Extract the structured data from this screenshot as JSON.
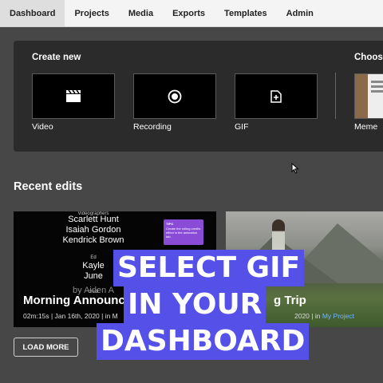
{
  "nav": {
    "tabs": [
      {
        "label": "Dashboard",
        "active": true
      },
      {
        "label": "Projects"
      },
      {
        "label": "Media"
      },
      {
        "label": "Exports"
      },
      {
        "label": "Templates"
      },
      {
        "label": "Admin"
      }
    ]
  },
  "create_new": {
    "heading": "Create new",
    "items": [
      {
        "label": "Video",
        "icon": "clapperboard-icon"
      },
      {
        "label": "Recording",
        "icon": "record-icon"
      },
      {
        "label": "GIF",
        "icon": "gif-add-icon"
      }
    ]
  },
  "choose": {
    "heading": "Choose",
    "items": [
      {
        "label": "Meme"
      }
    ]
  },
  "recent": {
    "heading": "Recent edits",
    "cards": [
      {
        "title": "Morning Announc",
        "meta_prefix": "02m:15s | Jan 16th, 2020 | in M",
        "credits": {
          "role1": "Videographers",
          "names": [
            "Scarlett Hunt",
            "Isaiah Gordon",
            "Kendrick Brown"
          ],
          "role2": "Ed",
          "partial_names": [
            "Kayle",
            "June"
          ],
          "role3": "credi",
          "byline": "by Aiden A"
        },
        "tip": {
          "heading": "TIPS",
          "body": "Create the rolling credits effect in the animation tab."
        }
      },
      {
        "title": "g Trip",
        "meta_prefix": "2020 | in ",
        "meta_link": "My Project"
      }
    ]
  },
  "load_more": "LOAD MORE",
  "overlay": {
    "lines": [
      "SELECT GIF",
      "IN YOUR",
      "DASHBOARD"
    ],
    "color": "#5450e8"
  }
}
